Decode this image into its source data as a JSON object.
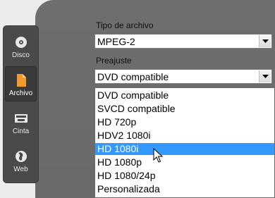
{
  "sidebar": {
    "items": [
      {
        "label": "Disco",
        "icon": "disc-icon"
      },
      {
        "label": "Archivo",
        "icon": "file-icon",
        "active": true
      },
      {
        "label": "Cinta",
        "icon": "tape-icon"
      },
      {
        "label": "Web",
        "icon": "globe-icon"
      }
    ]
  },
  "form": {
    "file_type_label": "Tipo de archivo",
    "file_type_value": "MPEG-2",
    "preset_label": "Preajuste",
    "preset_value": "DVD compatible"
  },
  "preset_options": [
    "DVD compatible",
    "SVCD compatible",
    "HD 720p",
    "HDV2 1080i",
    "HD 1080i",
    "HD 1080p",
    "HD 1080/24p",
    "Personalizada"
  ],
  "highlighted_option": "HD 1080i",
  "colors": {
    "highlight": "#3399ff",
    "sidebar": "#4a4a4a",
    "panel": "#6e6e6e",
    "file_icon": "#f39a2e"
  }
}
